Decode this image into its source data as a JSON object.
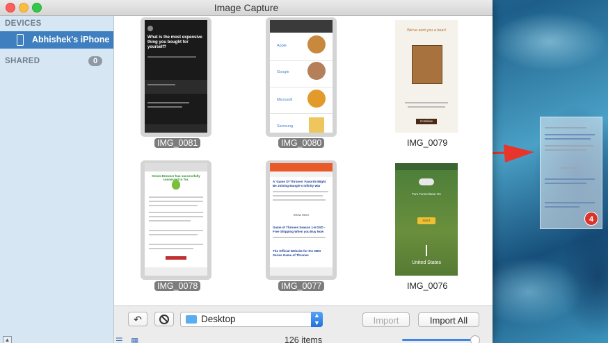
{
  "window": {
    "title": "Image Capture"
  },
  "sidebar": {
    "devices_header": "DEVICES",
    "device_name": "Abhishek's iPhone",
    "shared_header": "SHARED",
    "shared_count": "0"
  },
  "thumbnails": [
    {
      "label": "IMG_0081",
      "selected": true
    },
    {
      "label": "IMG_0080",
      "selected": true
    },
    {
      "label": "IMG_0079",
      "selected": false
    },
    {
      "label": "IMG_0078",
      "selected": true
    },
    {
      "label": "IMG_0077",
      "selected": true
    },
    {
      "label": "IMG_0076",
      "selected": false
    }
  ],
  "thumb_content": {
    "img81_headline": "What is the most expensive thing you bought for yourself?",
    "img80_labels": [
      "Apple",
      "Google",
      "Microsoft",
      "Samsung"
    ],
    "img79_headline": "We've sent you a bear!",
    "img79_button": "Continue",
    "img78_title": "Onion Browser has successfully connected to Tor.",
    "img77_headline": "A 'Game Of Thrones' Favorite Might Be Joining Bungie's Infinity War",
    "img77_show_more": "Show More",
    "img77_item2": "Game of Thrones Season 1-6 DVD - Free Shipping When you Buy Now",
    "img77_item3": "The Official Website for the HBO Series Game of Thrones",
    "img76_text1": "Turn Tunnel Bear On",
    "img76_button": "Got It",
    "img76_country": "United States"
  },
  "toolbar": {
    "rotate_icon": "rotate-left-icon",
    "delete_icon": "no-entry-icon",
    "destination": "Desktop",
    "import_label": "Import",
    "import_all_label": "Import All",
    "items_count": "126 items"
  },
  "drag": {
    "badge_count": "4"
  },
  "colors": {
    "selection": "#3f7fbf",
    "accent": "#3d86e6",
    "arrow": "#e8342a",
    "badge": "#d9342b"
  }
}
